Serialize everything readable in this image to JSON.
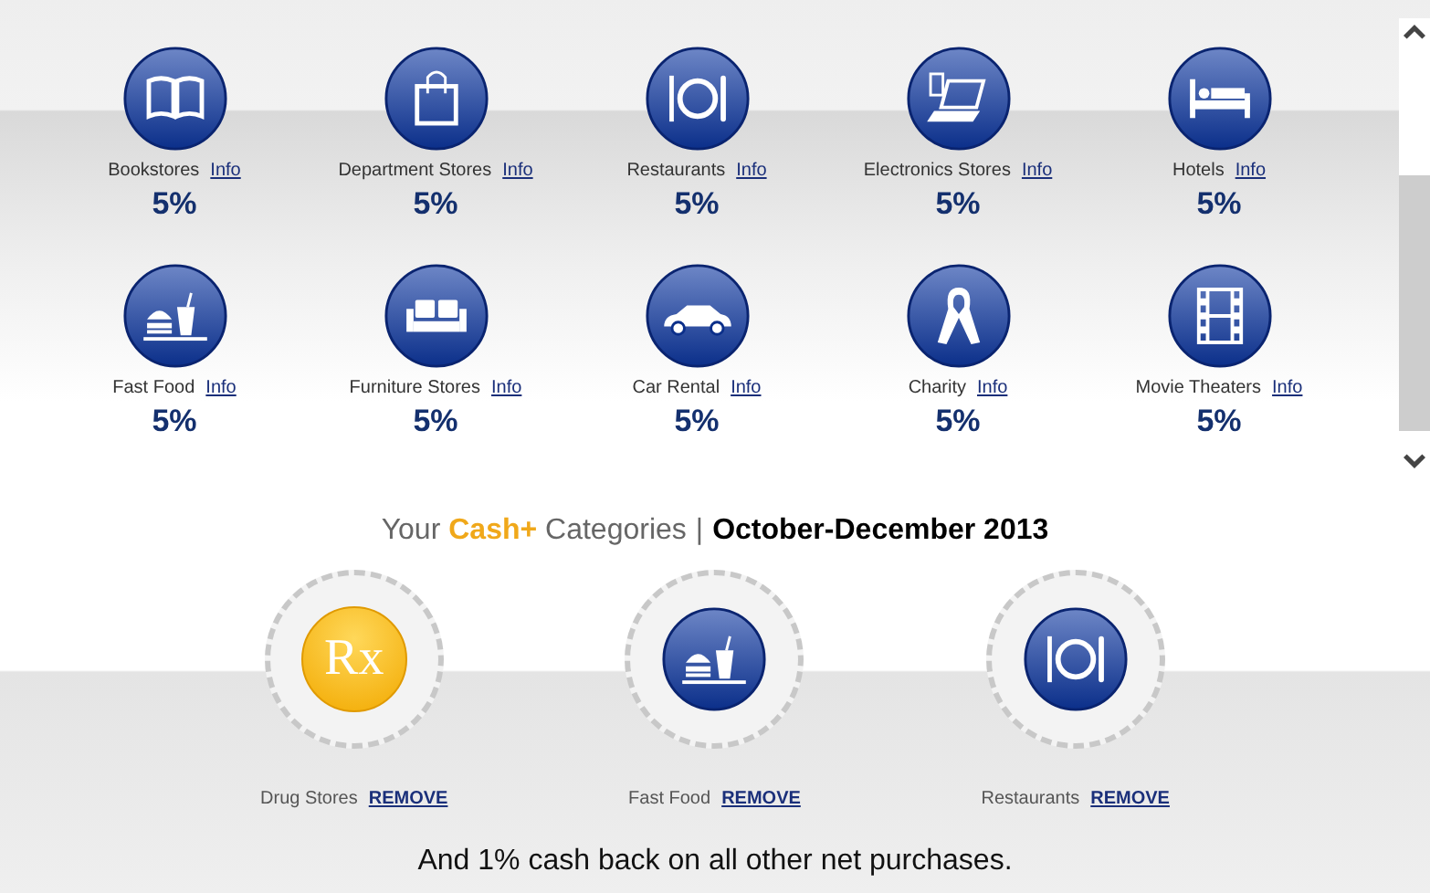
{
  "categories": [
    {
      "name": "Bookstores",
      "link": "Info",
      "percent": "5%",
      "kind": "book"
    },
    {
      "name": "Department Stores",
      "link": "Info",
      "percent": "5%",
      "kind": "bag"
    },
    {
      "name": "Restaurants",
      "link": "Info",
      "percent": "5%",
      "kind": "dining"
    },
    {
      "name": "Electronics Stores",
      "link": "Info",
      "percent": "5%",
      "kind": "electronics"
    },
    {
      "name": "Hotels",
      "link": "Info",
      "percent": "5%",
      "kind": "bed"
    },
    {
      "name": "Fast Food",
      "link": "Info",
      "percent": "5%",
      "kind": "fastfood"
    },
    {
      "name": "Furniture Stores",
      "link": "Info",
      "percent": "5%",
      "kind": "sofa"
    },
    {
      "name": "Car Rental",
      "link": "Info",
      "percent": "5%",
      "kind": "car"
    },
    {
      "name": "Charity",
      "link": "Info",
      "percent": "5%",
      "kind": "ribbon"
    },
    {
      "name": "Movie Theaters",
      "link": "Info",
      "percent": "5%",
      "kind": "film"
    }
  ],
  "heading": {
    "prefix": "Your",
    "brand": "Cash+",
    "suffix": "Categories",
    "separator": "|",
    "period": "October-December 2013"
  },
  "selected_categories": [
    {
      "name": "Drug Stores",
      "link": "REMOVE",
      "kind": "rx",
      "symbol": "Rx"
    },
    {
      "name": "Fast Food",
      "link": "REMOVE",
      "kind": "fastfood"
    },
    {
      "name": "Restaurants",
      "link": "REMOVE",
      "kind": "dining"
    }
  ],
  "footer": "And 1% cash back on all other net purchases."
}
